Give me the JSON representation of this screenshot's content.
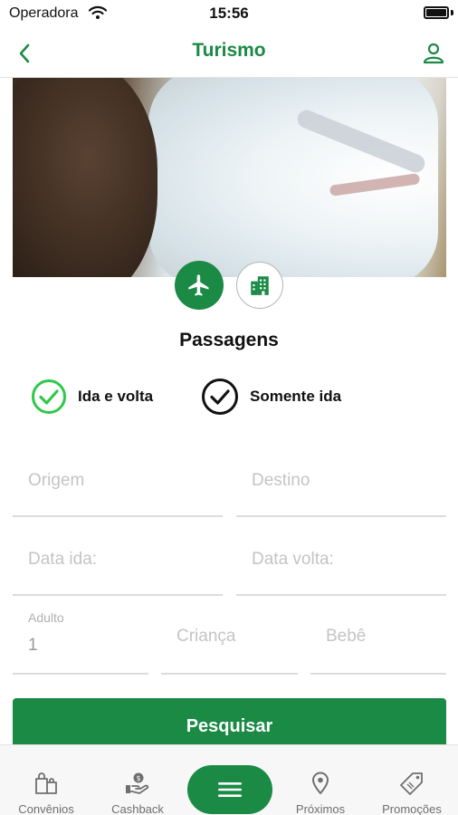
{
  "status": {
    "carrier": "Operadora",
    "time": "15:56",
    "icons": [
      "wifi-icon",
      "battery-icon"
    ]
  },
  "header": {
    "title": "Turismo",
    "back_icon": "chevron-left-icon",
    "profile_icon": "user-icon"
  },
  "hero": {
    "image": "airplane-window-photo"
  },
  "modes": [
    {
      "name": "passagens",
      "icon": "airplane-icon",
      "selected": true
    },
    {
      "name": "hoteis",
      "icon": "building-icon",
      "selected": false
    }
  ],
  "section": {
    "title": "Passagens"
  },
  "trip_type": {
    "round_trip": "Ida e volta",
    "one_way": "Somente ida",
    "selected": "round_trip"
  },
  "form": {
    "origin_placeholder": "Origem",
    "destination_placeholder": "Destino",
    "departure_placeholder": "Data ida:",
    "return_placeholder": "Data volta:",
    "adult_label": "Adulto",
    "adult_value": "1",
    "child_placeholder": "Criança",
    "baby_placeholder": "Bebê",
    "search_label": "Pesquisar"
  },
  "colors": {
    "accent": "#1a8a45",
    "check_selected": "#2ec84a",
    "check_unselected": "#111111"
  },
  "tabs": [
    {
      "label": "Convênios",
      "icon": "shopping-bags-icon"
    },
    {
      "label": "Cashback",
      "icon": "hand-coin-icon"
    },
    {
      "label": "",
      "icon": "menu-icon"
    },
    {
      "label": "Próximos",
      "icon": "location-pin-icon"
    },
    {
      "label": "Promoções",
      "icon": "tag-icon"
    }
  ]
}
